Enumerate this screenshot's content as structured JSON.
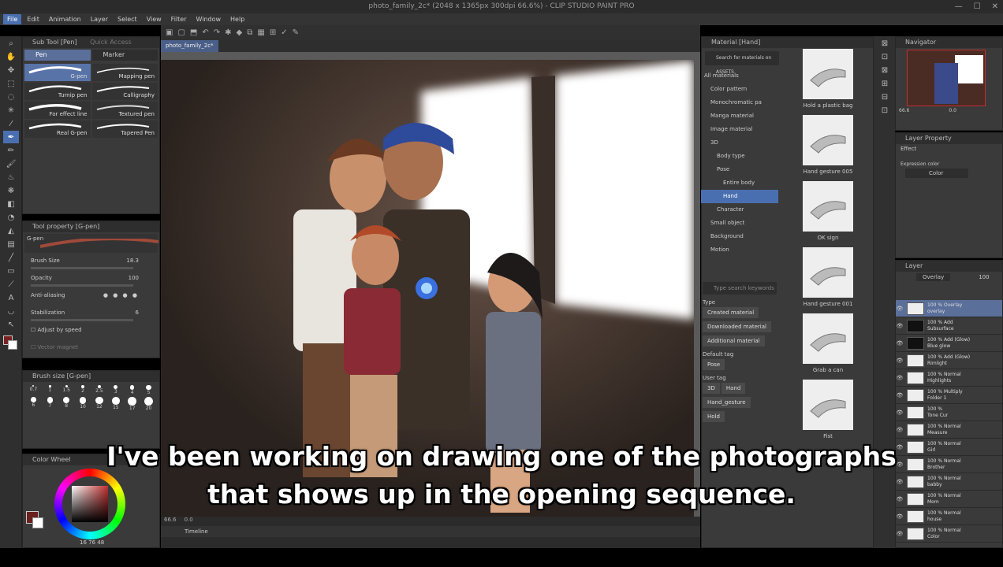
{
  "title": "photo_family_2c* (2048 x 1365px 300dpi 66.6%) - CLIP STUDIO PAINT PRO",
  "menu": [
    "File",
    "Edit",
    "Animation",
    "Layer",
    "Select",
    "View",
    "Filter",
    "Window",
    "Help"
  ],
  "canvas_tab": "photo_family_2c*",
  "subtool": {
    "title": "Sub Tool [Pen]",
    "title2": "Quick Access",
    "tabs": [
      "Pen",
      "Marker"
    ],
    "pens": [
      "G-pen",
      "Mapping pen",
      "Turnip pen",
      "Calligraphy",
      "For effect line",
      "Textured pen",
      "Real G-pen",
      "Tapered Pen"
    ]
  },
  "toolprop": {
    "title": "Tool property [G-pen]",
    "name": "G-pen",
    "brush_size_label": "Brush Size",
    "brush_size": "18.3",
    "opacity_label": "Opacity",
    "opacity": "100",
    "antialias_label": "Anti-aliasing",
    "stabilization_label": "Stabilization",
    "stabilization": "6",
    "adjust_label": "Adjust by speed",
    "vector_label": "Vector magnet"
  },
  "brushsize": {
    "title": "Brush size [G-pen]",
    "sizes": [
      "0.7",
      "1",
      "1.5",
      "2",
      "2.5",
      "3",
      "4",
      "5",
      "6",
      "7",
      "8",
      "10",
      "12",
      "15",
      "17",
      "20"
    ]
  },
  "colorwheel": {
    "title": "Color Wheel",
    "values": "16  76  48"
  },
  "zoom": "66.6",
  "rotation": "0.0",
  "timeline": "Timeline",
  "material": {
    "title": "Material [Hand]",
    "search_assets": "Search for materials on ASSETS",
    "tree": [
      "All materials",
      "Color pattern",
      "Monochromatic pa",
      "Manga material",
      "Image material",
      "3D",
      "Body type",
      "Pose",
      "Entire body",
      "Hand",
      "Character",
      "Small object",
      "Background",
      "Motion"
    ],
    "search_placeholder": "Type search keywords",
    "type_label": "Type",
    "types": [
      "Created material",
      "Downloaded material",
      "Additional material"
    ],
    "default_tag_label": "Default tag",
    "default_tags": [
      "Pose"
    ],
    "user_tag_label": "User tag",
    "user_tags": [
      "3D",
      "Hand",
      "Hand_gesture",
      "Hold"
    ],
    "thumbs": [
      "Hold a plastic bag",
      "Hand gesture 005",
      "OK sign",
      "Hand gesture 001",
      "Grab a can",
      "Fist"
    ]
  },
  "navigator": {
    "title": "Navigator",
    "zoom": "66.6",
    "angle": "0.0"
  },
  "layerprop": {
    "title": "Layer Property",
    "effect": "Effect",
    "expr_label": "Expression color",
    "expr_value": "Color"
  },
  "layers": {
    "title": "Layer",
    "blend": "Overlay",
    "opacity": "100",
    "items": [
      {
        "mode": "100 % Overlay",
        "name": "overlay"
      },
      {
        "mode": "100 % Add",
        "name": "Subsurface"
      },
      {
        "mode": "100 % Add (Glow)",
        "name": "Blue glow"
      },
      {
        "mode": "100 % Add (Glow)",
        "name": "Rimlight"
      },
      {
        "mode": "100 % Normal",
        "name": "Highlights"
      },
      {
        "mode": "100 % Multiply",
        "name": "Folder 1"
      },
      {
        "mode": "100 %",
        "name": "Tone Cur"
      },
      {
        "mode": "100 % Normal",
        "name": "Measure"
      },
      {
        "mode": "100 % Normal",
        "name": "Girl"
      },
      {
        "mode": "100 % Normal",
        "name": "Brother"
      },
      {
        "mode": "100 % Normal",
        "name": "babby"
      },
      {
        "mode": "100 % Normal",
        "name": "Mom"
      },
      {
        "mode": "100 % Normal",
        "name": "house"
      },
      {
        "mode": "100 % Normal",
        "name": "Color"
      }
    ]
  },
  "subtitle": [
    "I've been working on drawing one of the photographs",
    "that shows up in the opening sequence."
  ]
}
